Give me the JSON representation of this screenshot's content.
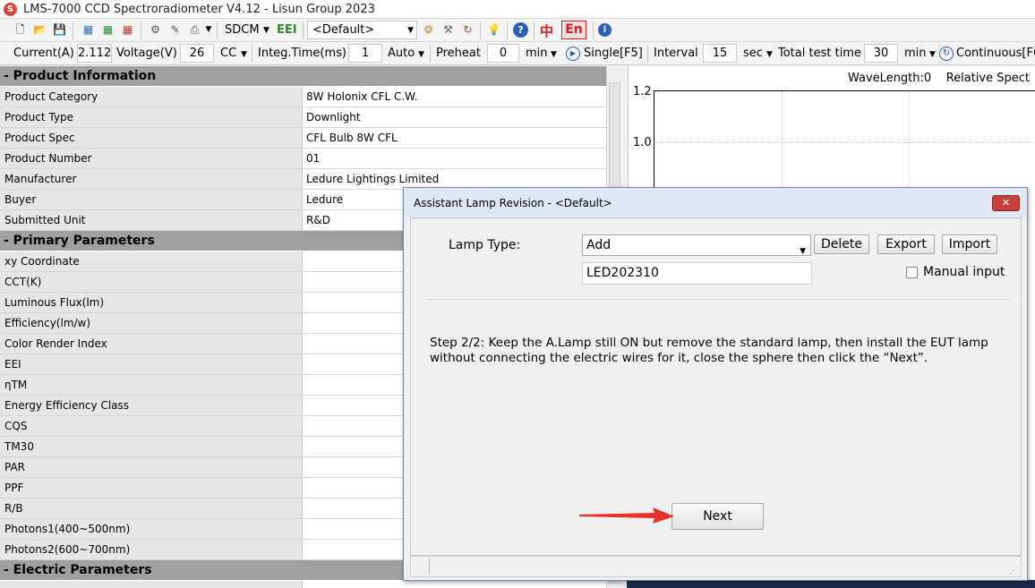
{
  "app": {
    "title": "LMS-7000 CCD Spectroradiometer V4.12 - Lisun Group 2023",
    "icon": "app-logo-icon"
  },
  "toolbar1": {
    "icons": [
      "new-icon",
      "open-icon",
      "save-icon",
      "table-icon",
      "table-add-icon",
      "table-delete-icon",
      "settings-tools-icon",
      "edit-icon",
      "print-icon",
      "chevron-down-icon"
    ],
    "sdcm_label": "SDCM",
    "eei_label": "EEI",
    "profile_value": "<Default>",
    "lang_cn": "中",
    "lang_en": "En",
    "colors": {
      "eei": "#2e8b2e",
      "lang_cn": "#d21f1f",
      "lang_en_border": "#d21f1f"
    }
  },
  "toolbar2": {
    "current_label": "Current(A)",
    "current_value": "2.112",
    "voltage_label": "Voltage(V)",
    "voltage_value": "26",
    "cc_label": "CC",
    "integ_label": "Integ.Time(ms)",
    "integ_value": "1",
    "auto_label": "Auto",
    "preheat_label": "Preheat",
    "preheat_value": "0",
    "preheat_unit": "min",
    "single_label": "Single[F5]",
    "interval_label": "Interval",
    "interval_value": "15",
    "interval_unit": "sec",
    "total_label": "Total test time",
    "total_value": "30",
    "total_unit": "min",
    "continuous_label": "Continuous[F6"
  },
  "grid": {
    "sections": [
      {
        "title": "- Product Information"
      },
      {
        "title": "- Primary Parameters"
      },
      {
        "title": "- Electric Parameters"
      }
    ],
    "product_rows": [
      {
        "label": "Product Category",
        "value": "8W Holonix CFL C.W."
      },
      {
        "label": "Product Type",
        "value": "Downlight"
      },
      {
        "label": "Product Spec",
        "value": "CFL Bulb  8W CFL"
      },
      {
        "label": "Product Number",
        "value": "01"
      },
      {
        "label": "Manufacturer",
        "value": "Ledure Lightings Limited"
      },
      {
        "label": "Buyer",
        "value": "Ledure"
      },
      {
        "label": "Submitted Unit",
        "value": "R&D"
      }
    ],
    "primary_rows": [
      {
        "label": "xy Coordinate",
        "value": ""
      },
      {
        "label": "CCT(K)",
        "value": ""
      },
      {
        "label": "Luminous Flux(lm)",
        "value": ""
      },
      {
        "label": "Efficiency(lm/w)",
        "value": ""
      },
      {
        "label": "Color Render Index",
        "value": ""
      },
      {
        "label": "EEI",
        "value": ""
      },
      {
        "label": "ηTM",
        "value": ""
      },
      {
        "label": "Energy Efficiency Class",
        "value": ""
      },
      {
        "label": "CQS",
        "value": ""
      },
      {
        "label": "TM30",
        "value": ""
      },
      {
        "label": "PAR",
        "value": ""
      },
      {
        "label": "PPF",
        "value": ""
      },
      {
        "label": "R/B",
        "value": ""
      },
      {
        "label": "Photons1(400~500nm)",
        "value": ""
      },
      {
        "label": "Photons2(600~700nm)",
        "value": ""
      }
    ]
  },
  "chart": {
    "wavelength_label": "WaveLength:0",
    "relative_label": "Relative Spect",
    "y_ticks": [
      "1.2",
      "1.0"
    ]
  },
  "dialog": {
    "title": "Assistant Lamp Revision - <Default>",
    "lamp_type_label": "Lamp Type:",
    "lamp_type_value": "Add",
    "delete_label": "Delete",
    "export_label": "Export",
    "import_label": "Import",
    "lamp_name_value": "LED202310",
    "manual_input_label": "Manual input",
    "step_text": "Step 2/2: Keep the A.Lamp still ON but remove the standard lamp, then install the EUT lamp without connecting the electric wires for it, close the sphere then click the “Next”.",
    "next_label": "Next",
    "close_icon": "close-icon"
  },
  "annotation": {
    "arrow_color": "#e8322a"
  }
}
